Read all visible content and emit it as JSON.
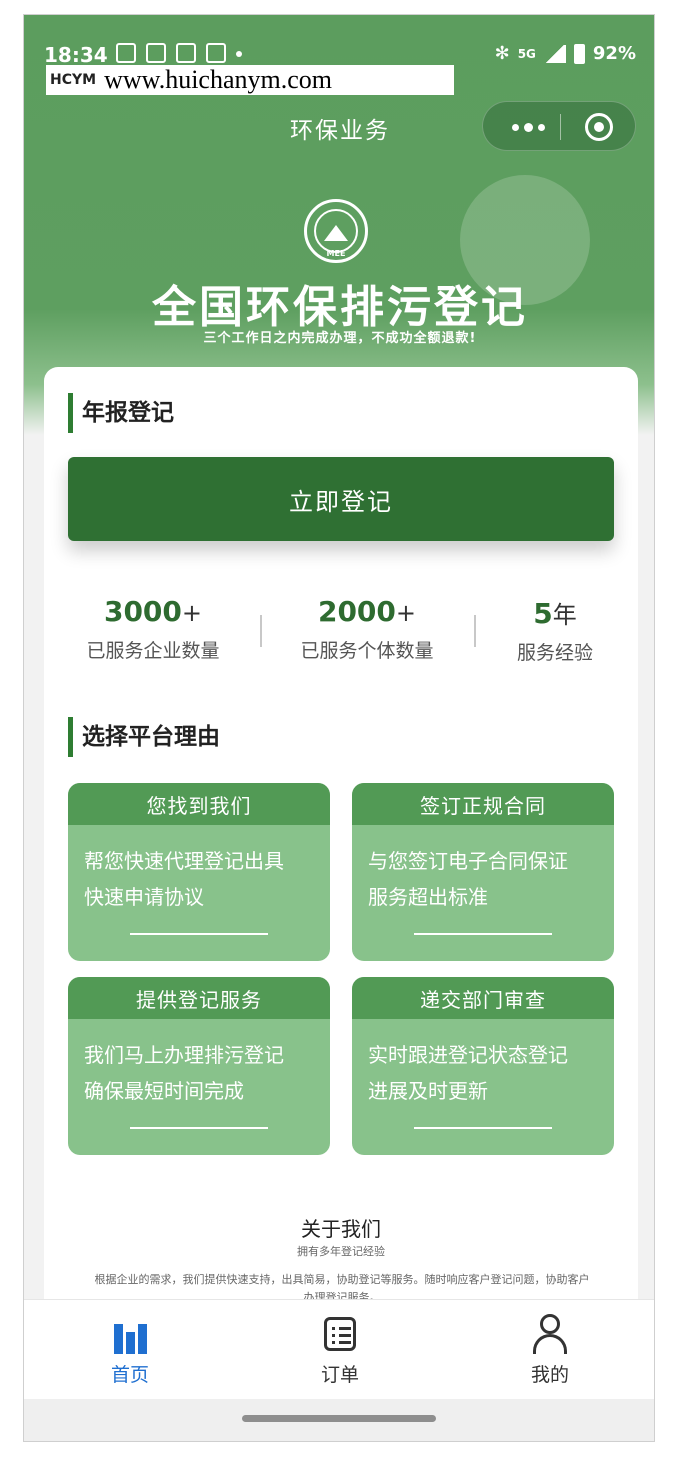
{
  "status_bar": {
    "time": "18:34",
    "battery": "92%",
    "network": "5G"
  },
  "watermark": {
    "logo": "HCYM",
    "url": "www.huichanym.com"
  },
  "nav": {
    "title": "环保业务"
  },
  "hero": {
    "emblem_text": "MEE",
    "title": "全国环保排污登记",
    "subtitle": "三个工作日之内完成办理，不成功全额退款!"
  },
  "annual": {
    "section_title": "年报登记",
    "button_label": "立即登记"
  },
  "stats": [
    {
      "value": "3000",
      "suffix": "+",
      "label": "已服务企业数量"
    },
    {
      "value": "2000",
      "suffix": "+",
      "label": "已服务个体数量"
    },
    {
      "value": "5",
      "suffix": "年",
      "label": "服务经验"
    }
  ],
  "reasons_section": {
    "title": "选择平台理由",
    "items": [
      {
        "head": "您找到我们",
        "line1": "帮您快速代理登记出具",
        "line2": "快速申请协议"
      },
      {
        "head": "签订正规合同",
        "line1": "与您签订电子合同保证",
        "line2": "服务超出标准"
      },
      {
        "head": "提供登记服务",
        "line1": "我们马上办理排污登记",
        "line2": "确保最短时间完成"
      },
      {
        "head": "递交部门审查",
        "line1": "实时跟进登记状态登记",
        "line2": "进展及时更新"
      }
    ]
  },
  "about": {
    "title": "关于我们",
    "subtitle": "拥有多年登记经验",
    "text": "根据企业的需求，我们提供快速支持，出具简易，协助登记等服务。随时响应客户登记问题，协助客户办理登记服务。"
  },
  "tabbar": {
    "items": [
      {
        "label": "首页",
        "icon": "home-icon",
        "active": true
      },
      {
        "label": "订单",
        "icon": "order-icon",
        "active": false
      },
      {
        "label": "我的",
        "icon": "user-icon",
        "active": false
      }
    ],
    "active_color": "#1f6fd0"
  },
  "colors": {
    "brand_green": "#5e9f60",
    "button_green": "#2f7033",
    "card_green": "#88c28b",
    "card_head_green": "#529a55"
  }
}
